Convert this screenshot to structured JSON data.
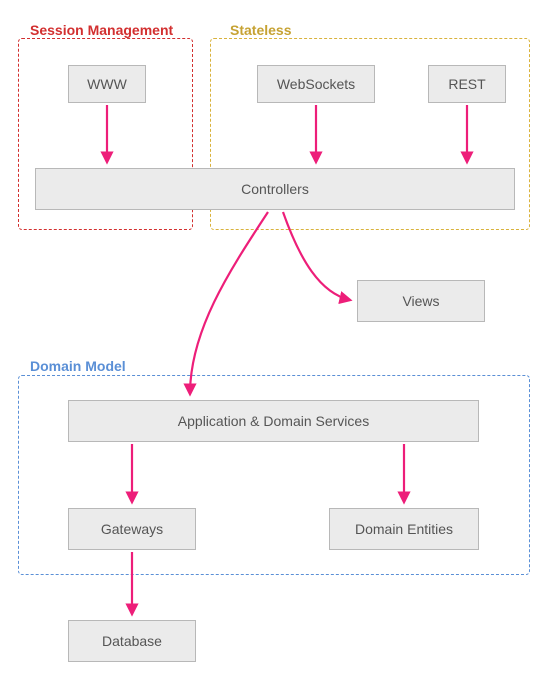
{
  "colors": {
    "session_border": "#d22f2f",
    "session_label": "#d22f2f",
    "stateless_border": "#d9b23c",
    "stateless_label": "#c6a233",
    "domain_border": "#5a8fd6",
    "domain_label": "#5a8fd6",
    "arrow": "#ed1e79",
    "node_bg": "#ebebeb",
    "node_border": "#b8b8b8",
    "node_text": "#555555"
  },
  "groups": {
    "session": {
      "label": "Session Management"
    },
    "stateless": {
      "label": "Stateless"
    },
    "domain": {
      "label": "Domain Model"
    }
  },
  "nodes": {
    "www": "WWW",
    "websockets": "WebSockets",
    "rest": "REST",
    "controllers": "Controllers",
    "views": "Views",
    "services": "Application & Domain Services",
    "gateways": "Gateways",
    "entities": "Domain Entities",
    "database": "Database"
  },
  "arrows": [
    {
      "from": "www",
      "to": "controllers"
    },
    {
      "from": "websockets",
      "to": "controllers"
    },
    {
      "from": "rest",
      "to": "controllers"
    },
    {
      "from": "controllers",
      "to": "views"
    },
    {
      "from": "controllers",
      "to": "services"
    },
    {
      "from": "services",
      "to": "gateways"
    },
    {
      "from": "services",
      "to": "entities"
    },
    {
      "from": "gateways",
      "to": "database"
    }
  ]
}
